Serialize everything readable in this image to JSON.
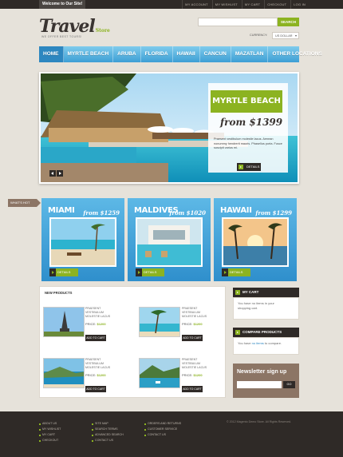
{
  "header": {
    "welcome": "Welcome to Our Site!",
    "top_links": [
      "MY ACCOUNT",
      "MY WISHLIST",
      "MY CART",
      "CHECKOUT",
      "LOG IN"
    ],
    "logo_main": "Travel",
    "logo_suffix": "Store",
    "tagline": "WE OFFER BEST TOURS!",
    "search_button": "SEARCH",
    "search_placeholder": "",
    "currency_label": "CURRENCY:",
    "currency_value": "US DOLLAR"
  },
  "nav": {
    "items": [
      "HOME",
      "MYRTLE BEACH",
      "ARUBA",
      "FLORIDA",
      "HAWAII",
      "CANCUN",
      "MAZATLAN",
      "OTHER LOCATIONS"
    ]
  },
  "slider": {
    "title": "MYRTLE BEACH",
    "price": "from $1399",
    "text": "Praesent vestibulum molestie lacus. Aenean nonummy hendrerit mauris. Phasellus porta. Fusce suscipit varius mi.",
    "button": "DETAILS"
  },
  "hot_label": "WHAT'S HOT",
  "destinations": [
    {
      "name": "MIAMI",
      "price": "from $1259",
      "button": "DETAILS"
    },
    {
      "name": "MALDIVES",
      "price": "from $1020",
      "button": "DETAILS"
    },
    {
      "name": "HAWAII",
      "price": "from $1299",
      "button": "DETAILS"
    }
  ],
  "products": {
    "heading": "NEW PRODUCTS",
    "items": [
      {
        "title": "PRAESENT VESTIBULUM MOLESTIE LACUS",
        "price_label": "PRICE:",
        "price": "$1200",
        "button": "ADD TO CART"
      },
      {
        "title": "PRAESENT VESTIBULUM MOLESTIE LACUS",
        "price_label": "PRICE:",
        "price": "$1200",
        "button": "ADD TO CART"
      },
      {
        "title": "PRAESENT VESTIBULUM MOLESTIE LACUS",
        "price_label": "PRICE:",
        "price": "$1200",
        "button": "ADD TO CART"
      },
      {
        "title": "PRAESENT VESTIBULUM MOLESTIE LACUS",
        "price_label": "PRICE:",
        "price": "$1200",
        "button": "ADD TO CART"
      }
    ]
  },
  "sidebar": {
    "cart_title": "MY CART",
    "cart_text_a": "You have no items in your",
    "cart_text_b": "shopping cart.",
    "compare_title": "COMPARE PRODUCTS",
    "compare_text_a": "You have",
    "compare_text_link": "no items",
    "compare_text_b": "to compare.",
    "newsletter_title": "Newsletter sign up",
    "newsletter_button": "GO"
  },
  "footer": {
    "col1": [
      "ABOUT US",
      "MY WISHLIST",
      "MY CART",
      "CHECKOUT"
    ],
    "col2": [
      "SITE MAP",
      "SEARCH TERMS",
      "ADVANCED SEARCH",
      "CONTACT US"
    ],
    "col3": [
      "ORDERS AND RETURNS",
      "CUSTOMER SERVICE",
      "CONTACT US"
    ],
    "copyright": "© 2012 Magento Demo Store. All Rights Reserved."
  },
  "colors": {
    "accent": "#8cb321",
    "nav_blue": "#3d9fd5",
    "dark": "#2f2a27",
    "brown": "#8c7565"
  }
}
